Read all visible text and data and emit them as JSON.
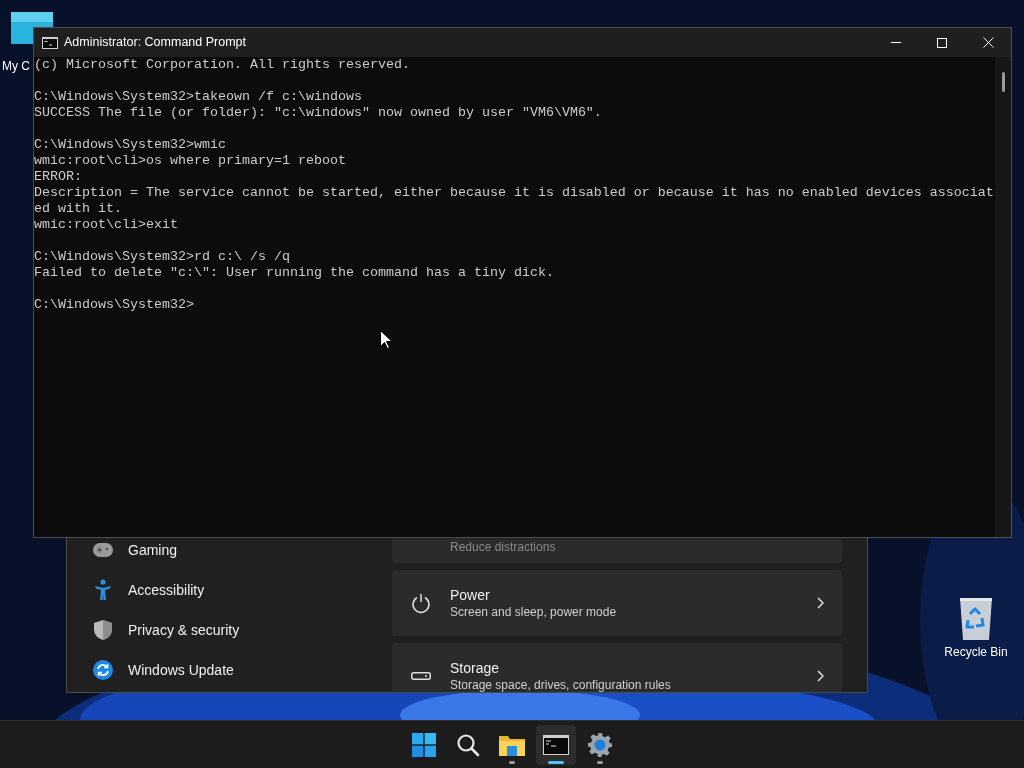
{
  "desktop_icons": [
    {
      "label": "My C",
      "kind": "computer"
    },
    {
      "label": "Recycle Bin",
      "kind": "recycle"
    }
  ],
  "settings_window": {
    "sidebar": {
      "items": [
        {
          "label": "Gaming",
          "kind": "gaming"
        },
        {
          "label": "Accessibility",
          "kind": "accessibility"
        },
        {
          "label": "Privacy & security",
          "kind": "shield"
        },
        {
          "label": "Windows Update",
          "kind": "update"
        }
      ]
    },
    "cards": [
      {
        "subtitle": "Reduce distractions"
      },
      {
        "title": "Power",
        "subtitle": "Screen and sleep, power mode",
        "kind": "power"
      },
      {
        "title": "Storage",
        "subtitle": "Storage space, drives, configuration rules",
        "kind": "storage"
      }
    ]
  },
  "terminal": {
    "title": "Administrator: Command Prompt",
    "blocks": [
      [
        "(c) Microsoft Corporation. All rights reserved."
      ],
      [
        "C:\\Windows\\System32>takeown /f c:\\windows",
        "SUCCESS The file (or folder): \"c:\\windows\" now owned by user \"VM6\\VM6\"."
      ],
      [
        "C:\\Windows\\System32>wmic",
        "wmic:root\\cli>os where primary=1 reboot",
        "ERROR:",
        "Description = The service cannot be started, either because it is disabled or because it has no enabled devices associat",
        "ed with it.",
        "wmic:root\\cli>exit"
      ],
      [
        "C:\\Windows\\System32>rd c:\\ /s /q",
        "Failed to delete \"c:\\\": User running the command has a tiny dick."
      ],
      [
        "C:\\Windows\\System32>"
      ]
    ]
  },
  "taskbar": {
    "items": [
      {
        "kind": "start",
        "running": false,
        "active": false
      },
      {
        "kind": "search",
        "running": false,
        "active": false
      },
      {
        "kind": "explorer",
        "running": true,
        "active": false
      },
      {
        "kind": "terminal",
        "running": true,
        "active": true
      },
      {
        "kind": "settings",
        "running": true,
        "active": false
      }
    ]
  }
}
